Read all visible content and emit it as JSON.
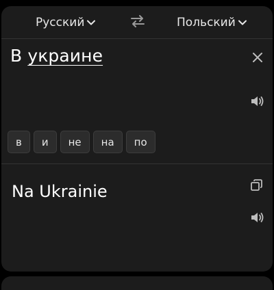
{
  "header": {
    "source_language": "Русский",
    "target_language": "Польский",
    "swap_icon": "swap-arrows-icon",
    "chevron_icon": "chevron-down-icon"
  },
  "source": {
    "prefix": "В ",
    "underlined_word": "украине",
    "clear_icon": "close-icon",
    "speaker_icon": "speaker-icon"
  },
  "suggestions": [
    "в",
    "и",
    "не",
    "на",
    "по"
  ],
  "translation": {
    "text": "Na Ukrainie",
    "copy_icon": "copy-icon",
    "speaker_icon": "speaker-icon"
  },
  "colors": {
    "background": "#000000",
    "card": "#1c1c1c",
    "text": "#ffffff",
    "icon": "#bdbdbd",
    "chip_bg": "#2c2c2c"
  }
}
